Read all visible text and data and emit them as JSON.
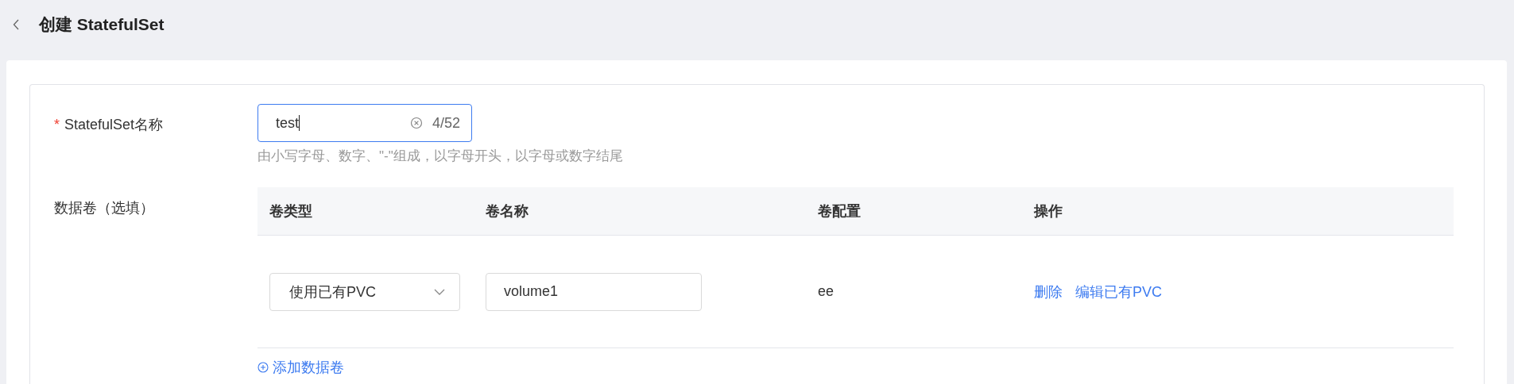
{
  "header": {
    "title": "创建 StatefulSet"
  },
  "name_field": {
    "label": "StatefulSet名称",
    "required_mark": "*",
    "value": "test",
    "counter": "4/52",
    "hint": "由小写字母、数字、\"-\"组成，以字母开头，以字母或数字结尾"
  },
  "volumes": {
    "label": "数据卷（选填）",
    "columns": [
      "卷类型",
      "卷名称",
      "卷配置",
      "操作"
    ],
    "rows": [
      {
        "type": "使用已有PVC",
        "name": "volume1",
        "config": "ee",
        "actions": [
          "删除",
          "编辑已有PVC"
        ]
      }
    ],
    "add_link": "添加数据卷"
  }
}
